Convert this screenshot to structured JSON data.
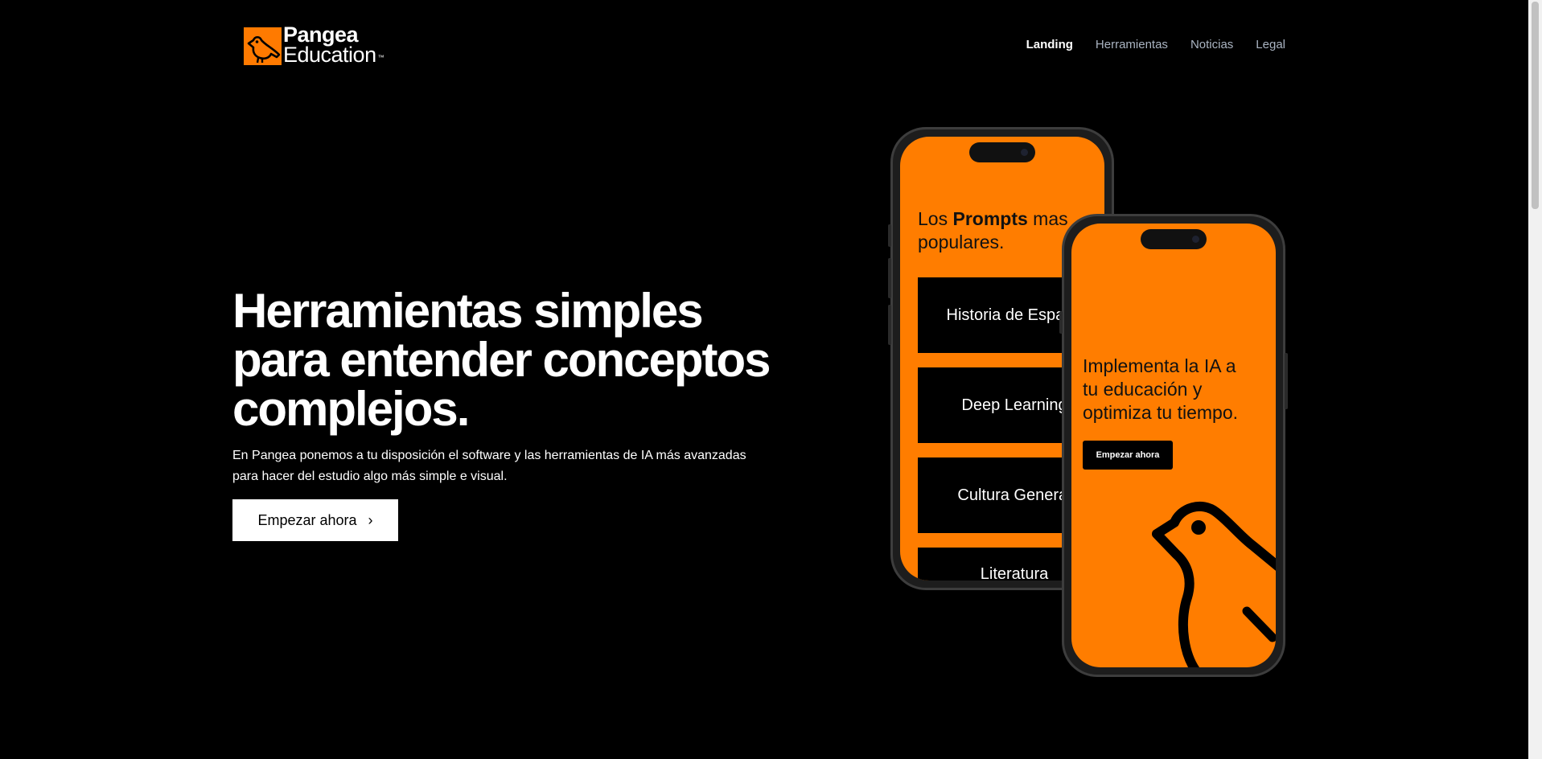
{
  "header": {
    "logo": {
      "line1": "Pangea",
      "line2": "Education",
      "trademark": "™",
      "icon": "bird-logo-icon",
      "brand_color": "#ff7a00"
    },
    "nav": [
      {
        "label": "Landing",
        "active": true
      },
      {
        "label": "Herramientas",
        "active": false
      },
      {
        "label": "Noticias",
        "active": false
      },
      {
        "label": "Legal",
        "active": false
      }
    ]
  },
  "hero": {
    "title_lines": [
      "Herramientas simples",
      "para entender conceptos",
      "complejos."
    ],
    "description_lines": [
      "En Pangea ponemos a tu disposición el software y las herramientas de IA más avanzadas",
      "para hacer del estudio algo más simple e visual."
    ],
    "cta_label": "Empezar ahora",
    "cta_icon": "›"
  },
  "phone_left": {
    "title_prefix": "Los ",
    "title_bold": "Prompts",
    "title_suffix": " mas",
    "title_line2": "populares.",
    "cards": [
      "Historia de España",
      "Deep Learning",
      "Cultura General",
      "Literatura"
    ]
  },
  "phone_right": {
    "title_lines": [
      "Implementa la IA a",
      "tu educación y",
      "optimiza tu tiempo."
    ],
    "button_label": "Empezar ahora"
  },
  "colors": {
    "accent": "#ff7d00",
    "background": "#000000"
  }
}
